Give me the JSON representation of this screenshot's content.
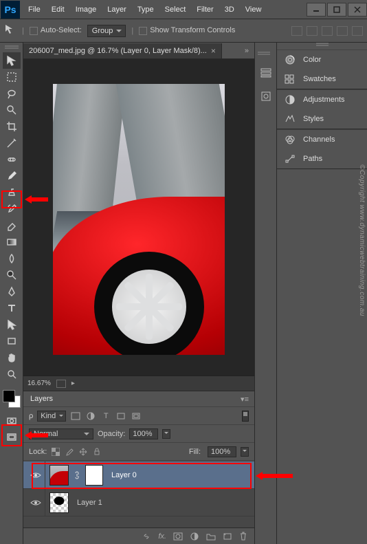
{
  "app": {
    "name": "Ps"
  },
  "menus": [
    "File",
    "Edit",
    "Image",
    "Layer",
    "Type",
    "Select",
    "Filter",
    "3D",
    "View"
  ],
  "options": {
    "autoSelect": "Auto-Select:",
    "group": "Group",
    "showTransform": "Show Transform Controls"
  },
  "document": {
    "tabTitle": "206007_med.jpg @ 16.7% (Layer 0, Layer Mask/8)...",
    "tabExpand": "»",
    "zoom": "16.67%"
  },
  "layersPanel": {
    "title": "Layers",
    "menuGlyph": "▾≡",
    "kindIcon": "ρ",
    "kindLabel": "Kind",
    "arrow": "▸",
    "blendMode": "Normal",
    "opacityLabel": "Opacity:",
    "opacityValue": "100%",
    "lockLabel": "Lock:",
    "fillLabel": "Fill:",
    "fillValue": "100%",
    "filterT": "T",
    "layers": [
      {
        "name": "Layer 0"
      },
      {
        "name": "Layer 1"
      }
    ],
    "fxLabel": "fx."
  },
  "rightPanels": {
    "rows": [
      {
        "label": "Color"
      },
      {
        "label": "Swatches"
      },
      {
        "label": "Adjustments"
      },
      {
        "label": "Styles"
      },
      {
        "label": "Channels"
      },
      {
        "label": "Paths"
      }
    ]
  },
  "watermark": "©Copyright www.dynamicwebtraining.com.au"
}
